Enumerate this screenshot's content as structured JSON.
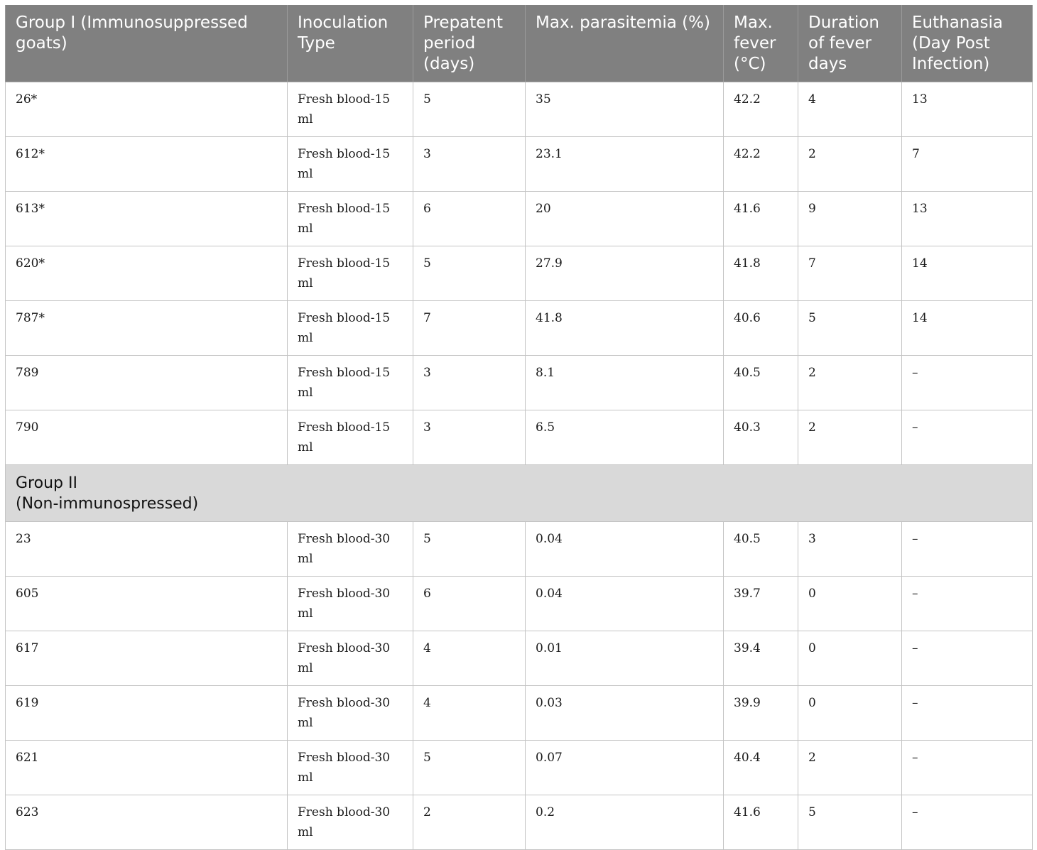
{
  "table": {
    "headers": [
      "Group I (Immunosuppressed goats)",
      "Inoculation Type",
      "Prepatent period (days)",
      "Max. parasitemia (%)",
      "Max. fever (°C)",
      "Duration of fever days",
      "Euthanasia (Day Post Infection)"
    ],
    "group1_rows": [
      [
        "26*",
        "Fresh blood-15 ml",
        "5",
        "35",
        "42.2",
        "4",
        "13"
      ],
      [
        "612*",
        "Fresh blood-15 ml",
        "3",
        "23.1",
        "42.2",
        "2",
        "7"
      ],
      [
        "613*",
        "Fresh blood-15 ml",
        "6",
        "20",
        "41.6",
        "9",
        "13"
      ],
      [
        "620*",
        "Fresh blood-15 ml",
        "5",
        "27.9",
        "41.8",
        "7",
        "14"
      ],
      [
        "787*",
        "Fresh blood-15 ml",
        "7",
        "41.8",
        "40.6",
        "5",
        "14"
      ],
      [
        "789",
        "Fresh blood-15 ml",
        "3",
        "8.1",
        "40.5",
        "2",
        "–"
      ],
      [
        "790",
        "Fresh blood-15 ml",
        "3",
        "6.5",
        "40.3",
        "2",
        "–"
      ]
    ],
    "group2_label_line1": "Group II",
    "group2_label_line2": "(Non-immunospressed)",
    "group2_rows": [
      [
        "23",
        "Fresh blood-30 ml",
        "5",
        "0.04",
        "40.5",
        "3",
        "–"
      ],
      [
        "605",
        "Fresh blood-30 ml",
        "6",
        "0.04",
        "39.7",
        "0",
        "–"
      ],
      [
        "617",
        "Fresh blood-30 ml",
        "4",
        "0.01",
        "39.4",
        "0",
        "–"
      ],
      [
        "619",
        "Fresh blood-30 ml",
        "4",
        "0.03",
        "39.9",
        "0",
        "–"
      ],
      [
        "621",
        "Fresh blood-30 ml",
        "5",
        "0.07",
        "40.4",
        "2",
        "–"
      ],
      [
        "623",
        "Fresh blood-30 ml",
        "2",
        "0.2",
        "41.6",
        "5",
        "–"
      ]
    ]
  }
}
